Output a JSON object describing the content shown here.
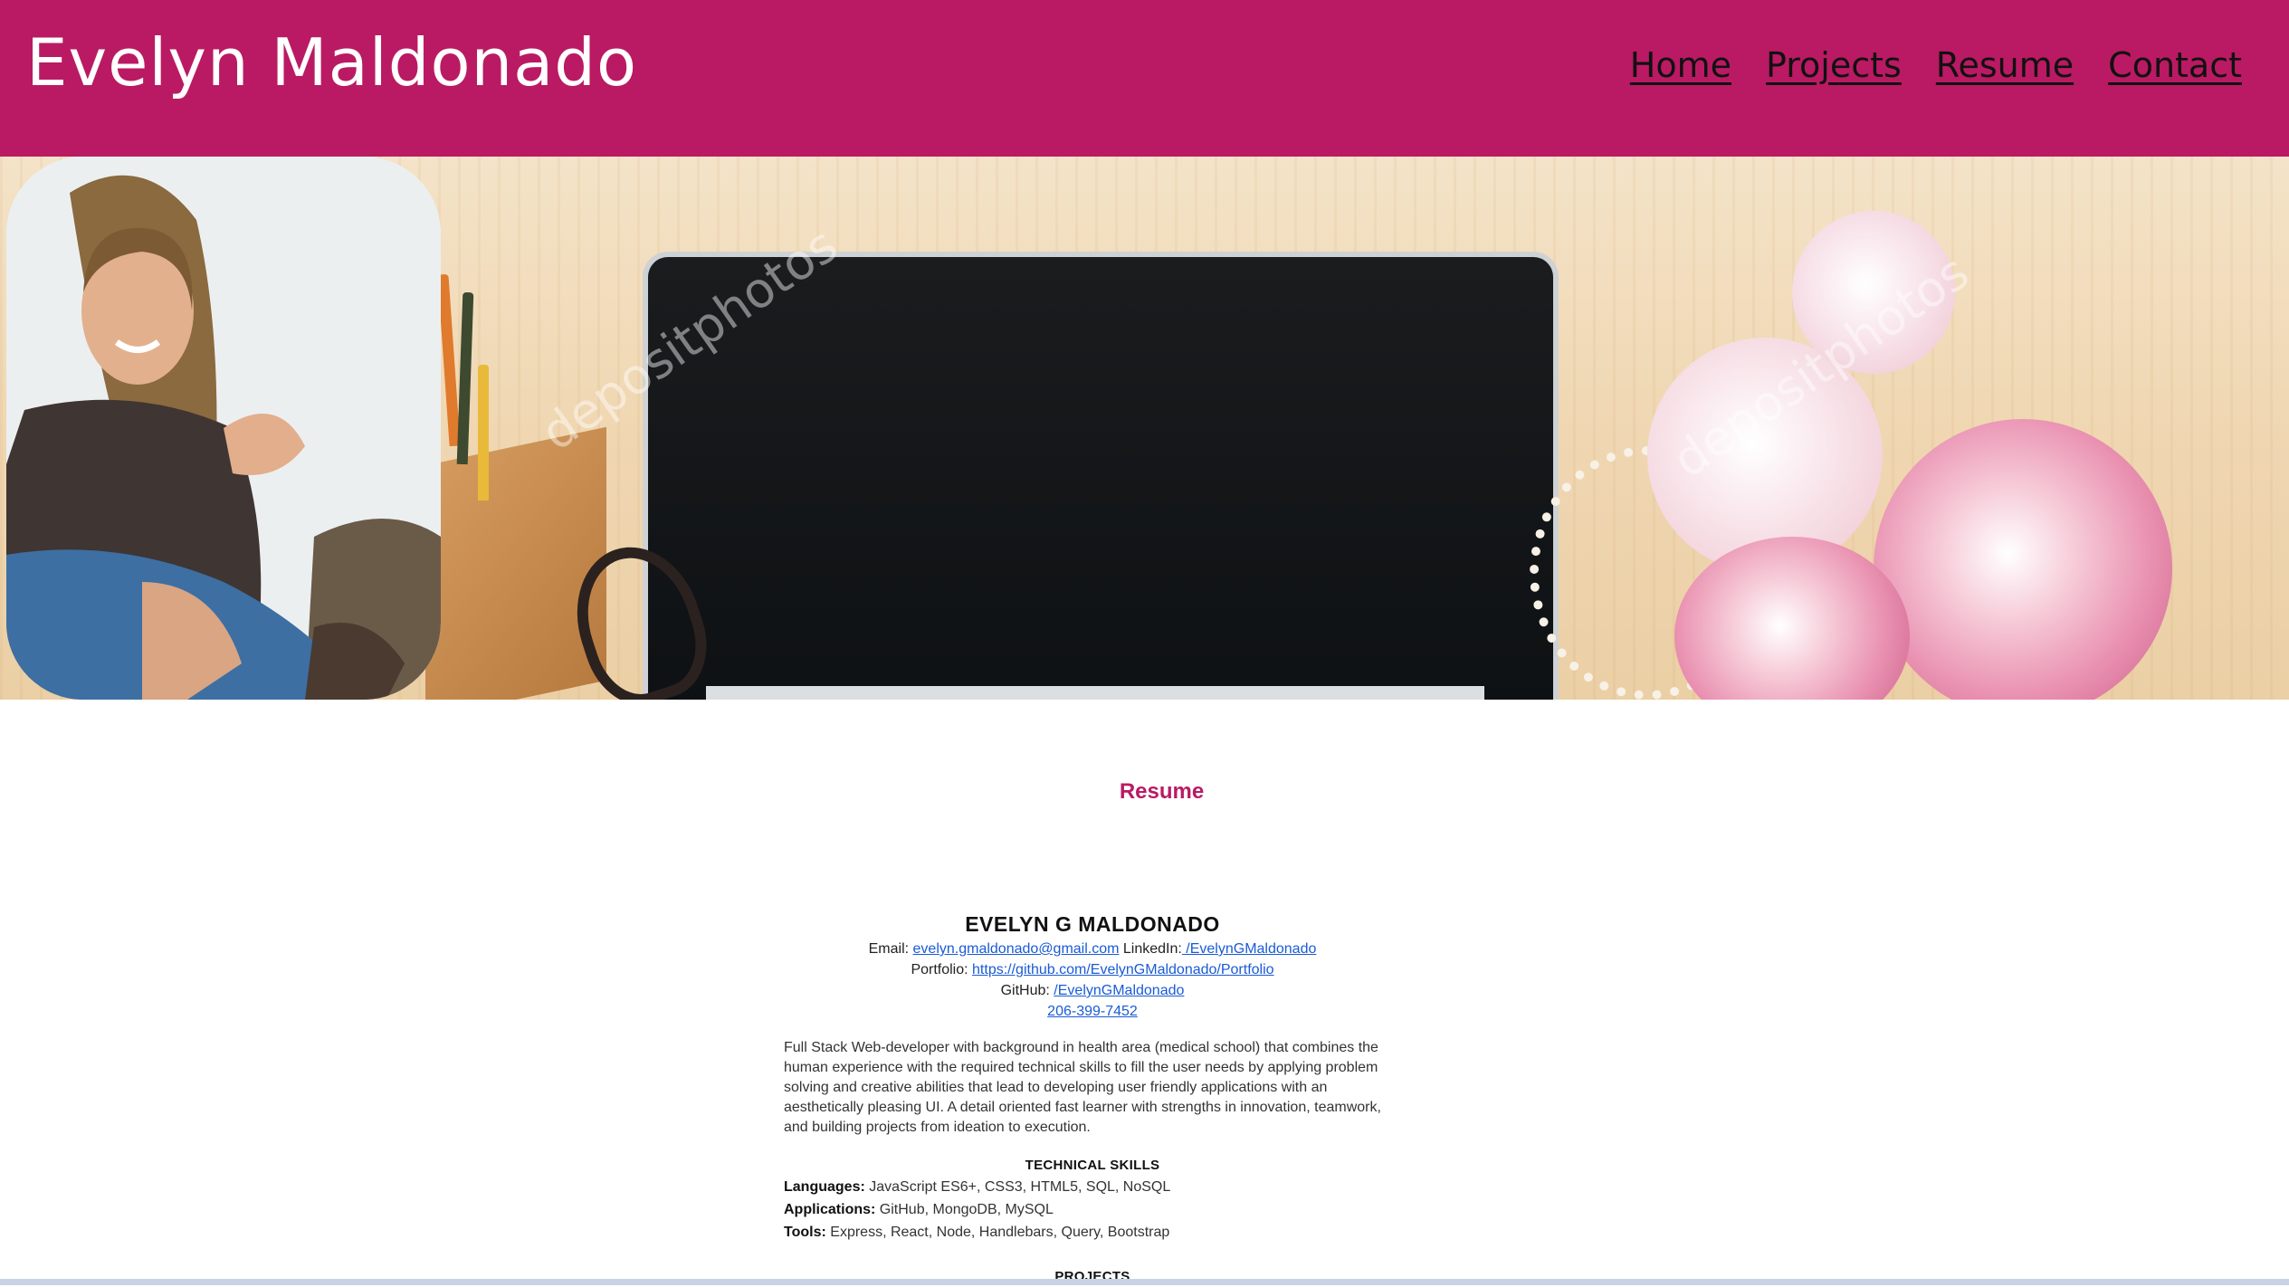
{
  "site": {
    "title": "Evelyn Maldonado"
  },
  "nav": {
    "items": [
      {
        "label": "Home"
      },
      {
        "label": "Projects"
      },
      {
        "label": "Resume"
      },
      {
        "label": "Contact"
      }
    ]
  },
  "hero": {
    "watermark_text": "depositphotos"
  },
  "section": {
    "title": "Resume"
  },
  "resume": {
    "name": "EVELYN G MALDONADO",
    "email_label": "Email:",
    "email": "evelyn.gmaldonado@gmail.com",
    "linkedin_label": "LinkedIn:",
    "linkedin": " /EvelynGMaldonado",
    "portfolio_label": "Portfolio:",
    "portfolio": "https://github.com/EvelynGMaldonado/Portfolio",
    "github_label": "GitHub:",
    "github": "/EvelynGMaldonado",
    "phone": "206-399-7452",
    "summary": "Full Stack Web-developer with background in health area (medical school) that combines the human experience with the required technical skills to fill the user needs by applying problem solving and creative abilities that lead to developing user friendly applications with an aesthetically pleasing UI. A detail oriented fast learner with strengths in innovation, teamwork, and building projects from ideation to execution.",
    "skills_heading": "TECHNICAL SKILLS",
    "skills": [
      {
        "label": "Languages:",
        "value": "JavaScript ES6+, CSS3, HTML5, SQL, NoSQL"
      },
      {
        "label": "Applications:",
        "value": "GitHub, MongoDB, MySQL"
      },
      {
        "label": "Tools:",
        "value": "Express, React, Node, Handlebars, Query, Bootstrap"
      }
    ],
    "projects_heading": "PROJECTS"
  },
  "colors": {
    "header_bg": "#ba1a63",
    "accent": "#ba1a63",
    "link": "#1a5bd6"
  }
}
